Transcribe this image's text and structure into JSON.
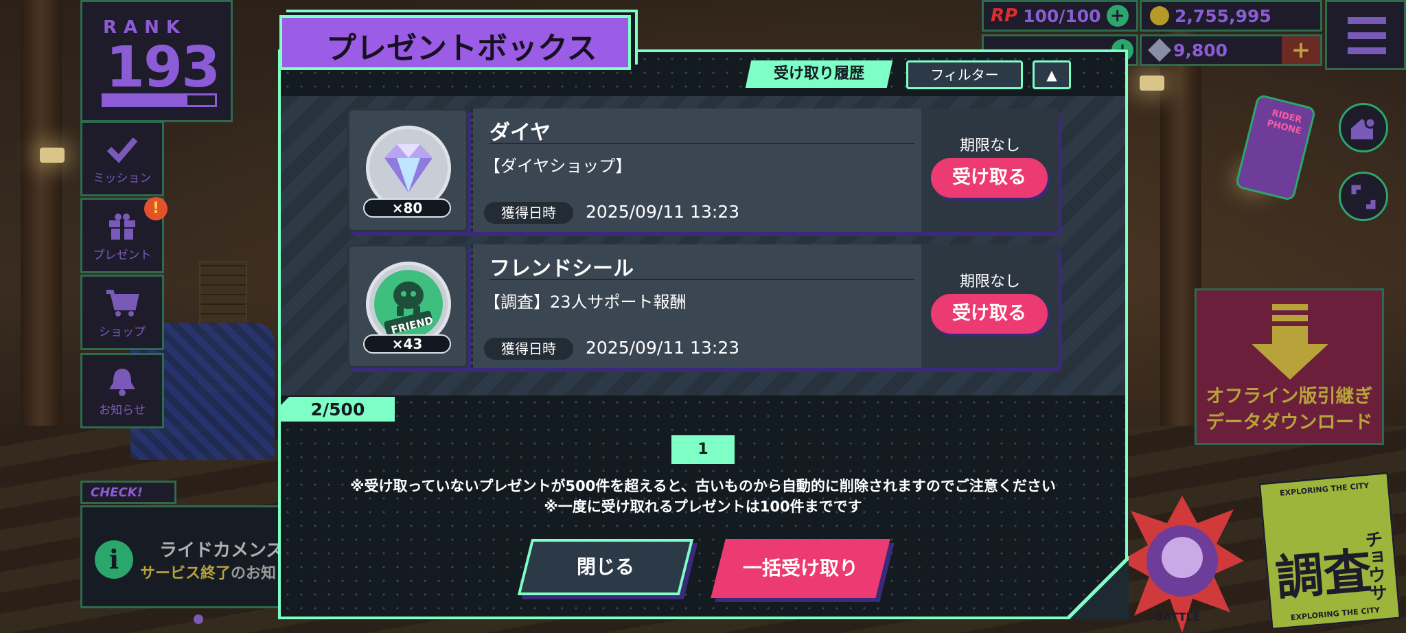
{
  "rank": {
    "label": "RANK",
    "value": "193",
    "progress": 0.75
  },
  "nav": {
    "mission": "ミッション",
    "present": "プレゼント",
    "shop": "ショップ",
    "news": "お知らせ",
    "present_badge": "!"
  },
  "check": {
    "tag": "CHECK!",
    "headline": "ライドカメンズ",
    "sub_highlight": "サービス終了",
    "sub_rest": "のお知"
  },
  "currency": {
    "rp_label": "RP",
    "rp_value": "100/100",
    "coins": "2,755,995",
    "gems": "9,800"
  },
  "side": {
    "rider_phone": "RIDER PHONE",
    "offline_text_1": "オフライン版引継ぎ",
    "offline_text_2": "データダウンロード",
    "sticker_top": "EXPLORING THE CITY",
    "sticker_big": "調査",
    "sticker_kana": "チョウサ",
    "sticker_bottom": "EXPLORING THE CITY",
    "battle_text": "BATTLE"
  },
  "modal": {
    "title": "プレゼントボックス",
    "history_button": "受け取り履歴",
    "filter_button": "フィルター",
    "sort_button": "▲",
    "items": [
      {
        "name": "ダイヤ",
        "source": "【ダイヤショップ】",
        "count": "×80",
        "date_label": "獲得日時",
        "date": "2025/09/11 13:23",
        "limit": "期限なし",
        "claim": "受け取る"
      },
      {
        "name": "フレンドシール",
        "source": "【調査】23人サポート報酬",
        "count": "×43",
        "date_label": "獲得日時",
        "date": "2025/09/11 13:23",
        "limit": "期限なし",
        "claim": "受け取る",
        "icon_text": "FRIEND"
      }
    ],
    "total_count": "2/500",
    "page": "1",
    "note_1": "※受け取っていないプレゼントが500件を超えると、古いものから自動的に削除されますのでご注意ください",
    "note_2": "※一度に受け取れるプレゼントは100件までです",
    "close_button": "閉じる",
    "bulk_button": "一括受け取り"
  },
  "colors": {
    "accent_green": "#7dffc6",
    "title_purple": "#9b5de5",
    "claim_pink": "#ec3a72",
    "panel": "#131a20"
  }
}
